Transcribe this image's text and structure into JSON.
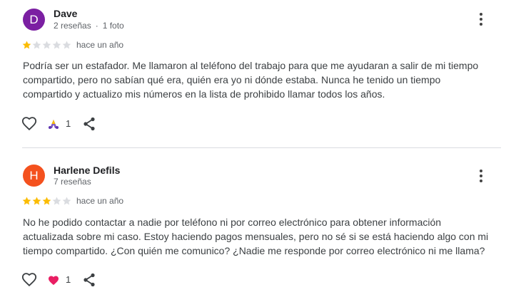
{
  "reviews": [
    {
      "initial": "D",
      "avatar_color": "#7b1fa2",
      "name": "Dave",
      "reviews_count": "2 reseñas",
      "photos": "1 foto",
      "rating": 1,
      "max_rating": 5,
      "date": "hace un año",
      "text_lines": [
        "Podría ser un estafador. Me llamaron al teléfono del trabajo para que me ayudaran a salir de mi tiempo",
        "compartido, pero no sabían qué era, quién era yo ni dónde estaba. Nunca he tenido un tiempo",
        "compartido y actualizo mis números en la lista de prohibido llamar todos los años."
      ],
      "reaction_icon": "celebrate-icon",
      "reaction_count": "1"
    },
    {
      "initial": "H",
      "avatar_color": "#f4511e",
      "name": "Harlene Defils",
      "reviews_count": "7 reseñas",
      "rating": 3,
      "max_rating": 5,
      "date": "hace un año",
      "text_lines": [
        "No he podido contactar a nadie por teléfono ni por correo electrónico para obtener información",
        "actualizada sobre mi caso. Estoy haciendo pagos mensuales, pero no sé si se está haciendo algo con mi",
        "tiempo compartido. ¿Con quién me comunico? ¿Nadie me responde por correo electrónico ni me llama?"
      ],
      "reaction_icon": "heart-reaction-icon",
      "reaction_count": "1"
    }
  ],
  "colors": {
    "star_filled": "#fbbc04",
    "star_empty": "#dadce0"
  }
}
